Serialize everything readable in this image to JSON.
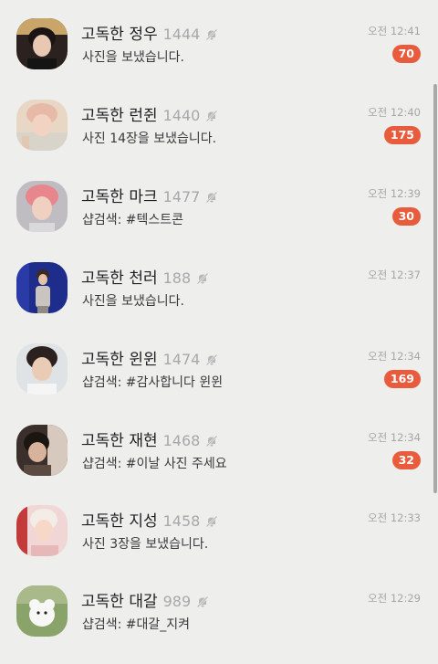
{
  "chats": [
    {
      "name": "고독한 정우",
      "count": "1444",
      "preview": "사진을 보냈습니다.",
      "time": "오전 12:41",
      "unread": "70"
    },
    {
      "name": "고독한 런쥔",
      "count": "1440",
      "preview": "사진 14장을 보냈습니다.",
      "time": "오전 12:40",
      "unread": "175"
    },
    {
      "name": "고독한 마크",
      "count": "1477",
      "preview": "샵검색: #텍스트콘",
      "time": "오전 12:39",
      "unread": "30"
    },
    {
      "name": "고독한 천러",
      "count": "188",
      "preview": "사진을 보냈습니다.",
      "time": "오전 12:37",
      "unread": ""
    },
    {
      "name": "고독한 윈윈",
      "count": "1474",
      "preview": "샵검색: #감사합니다 윈윈",
      "time": "오전 12:34",
      "unread": "169"
    },
    {
      "name": "고독한 재현",
      "count": "1468",
      "preview": "샵검색: #이날 사진 주세요",
      "time": "오전 12:34",
      "unread": "32"
    },
    {
      "name": "고독한 지성",
      "count": "1458",
      "preview": "사진 3장을 보냈습니다.",
      "time": "오전 12:33",
      "unread": ""
    },
    {
      "name": "고독한 대갈",
      "count": "989",
      "preview": "샵검색: #대갈_지켜",
      "time": "오전 12:29",
      "unread": ""
    }
  ],
  "icons": {
    "mute": "bell-off-icon"
  },
  "colors": {
    "background": "#eeeeed",
    "badge": "#e95b3d",
    "name": "#1f1f1f",
    "muted": "#a8a8a8"
  }
}
